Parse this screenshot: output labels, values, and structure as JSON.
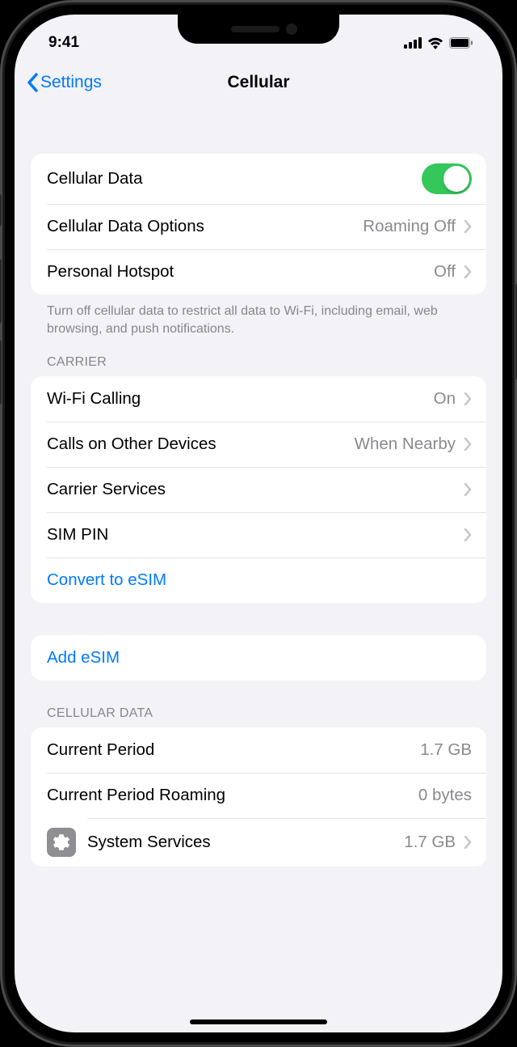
{
  "status": {
    "time": "9:41"
  },
  "nav": {
    "back": "Settings",
    "title": "Cellular"
  },
  "group1": {
    "cellular_data": "Cellular Data",
    "cellular_data_options": "Cellular Data Options",
    "cellular_data_options_value": "Roaming Off",
    "personal_hotspot": "Personal Hotspot",
    "personal_hotspot_value": "Off",
    "footer": "Turn off cellular data to restrict all data to Wi-Fi, including email, web browsing, and push notifications."
  },
  "carrier": {
    "header": "Carrier",
    "wifi_calling": "Wi-Fi Calling",
    "wifi_calling_value": "On",
    "calls_other": "Calls on Other Devices",
    "calls_other_value": "When Nearby",
    "carrier_services": "Carrier Services",
    "sim_pin": "SIM PIN",
    "convert_esim": "Convert to eSIM"
  },
  "esim": {
    "add": "Add eSIM"
  },
  "data": {
    "header": "Cellular Data",
    "current_period": "Current Period",
    "current_period_value": "1.7 GB",
    "roaming": "Current Period Roaming",
    "roaming_value": "0 bytes",
    "system_services": "System Services",
    "system_services_value": "1.7 GB"
  }
}
